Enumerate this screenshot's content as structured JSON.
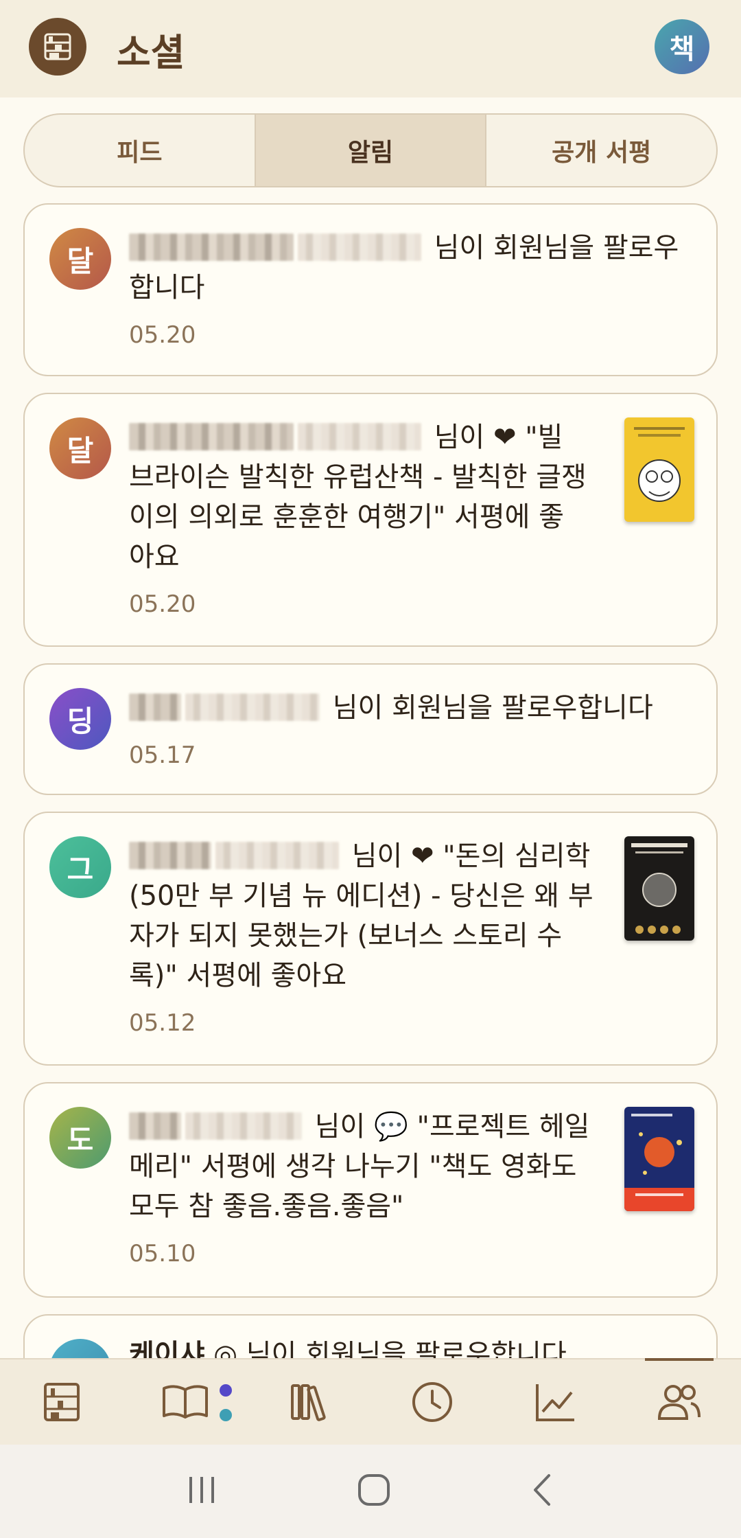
{
  "header": {
    "title": "소셜",
    "profile_initial": "책"
  },
  "tabs": [
    {
      "label": "피드",
      "active": false
    },
    {
      "label": "알림",
      "active": true
    },
    {
      "label": "공개 서평",
      "active": false
    }
  ],
  "notifications": [
    {
      "initial": "달",
      "line1": "님이 회원님을 팔로우",
      "line2": "합니다",
      "date": "05.20"
    },
    {
      "initial": "달",
      "line1": "님이 ❤ \"빌",
      "line2": "브라이슨 발칙한 유럽산책 - 발칙한 글쟁",
      "line3": "이의 의외로 훈훈한 여행기\" 서평에 좋",
      "line4": "아요",
      "date": "05.20"
    },
    {
      "initial": "딩",
      "line1": "님이 회원님을 팔로우합니다",
      "date": "05.17"
    },
    {
      "initial": "그",
      "line1": "님이 ❤ \"돈의 심리학",
      "line2": "(50만 부 기념 뉴 에디션) - 당신은 왜 부",
      "line3": "자가 되지 못했는가 (보너스 스토리 수",
      "line4": "록)\" 서평에 좋아요",
      "date": "05.12"
    },
    {
      "initial": "도",
      "line1": "님이 💬 \"프로젝트 헤일",
      "line2": "메리\" 서평에 생각 나누기 \"책도 영화도",
      "line3": "모두 참 좋음.좋음.좋음\"",
      "date": "05.10"
    },
    {
      "name": "케이샤",
      "line1": "◎ 님이 회원님을 팔로우합니다"
    }
  ],
  "colors": {
    "accent": "#6b4a2c",
    "background": "#fdfaf1",
    "avatar_1": "#c0703a",
    "avatar_3": "#6a4fc0",
    "avatar_4": "#4fba8f",
    "avatar_5": "#7fae55"
  },
  "bottom_nav": [
    "bookshelf-icon",
    "book-open-icon",
    "books-icon",
    "clock-icon",
    "chart-icon",
    "people-icon"
  ]
}
